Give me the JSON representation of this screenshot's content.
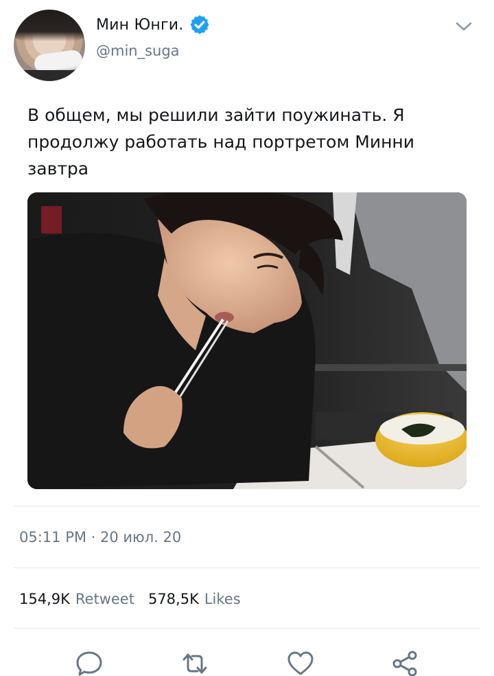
{
  "author": {
    "display_name": "Мин Юнги.",
    "handle": "@min_suga",
    "verified": true
  },
  "tweet": {
    "text_lines": [
      "В общем, мы решили зайти поужинать. Я",
      "продолжу работать над портретом Минни",
      "завтра"
    ],
    "timestamp": "05:11 PM · 20 июл. 20"
  },
  "stats": {
    "retweets_count": "154,9K",
    "retweets_label": "Retweet",
    "likes_count": "578,5K",
    "likes_label": "Likes"
  },
  "icons": {
    "menu": "chevron-down-icon",
    "reply": "reply-icon",
    "retweet": "retweet-icon",
    "like": "heart-icon",
    "share": "share-icon",
    "verified": "verified-badge-icon"
  },
  "colors": {
    "verified_blue": "#1da1f2",
    "secondary_text": "#657786",
    "divider": "#e1e8ed"
  }
}
